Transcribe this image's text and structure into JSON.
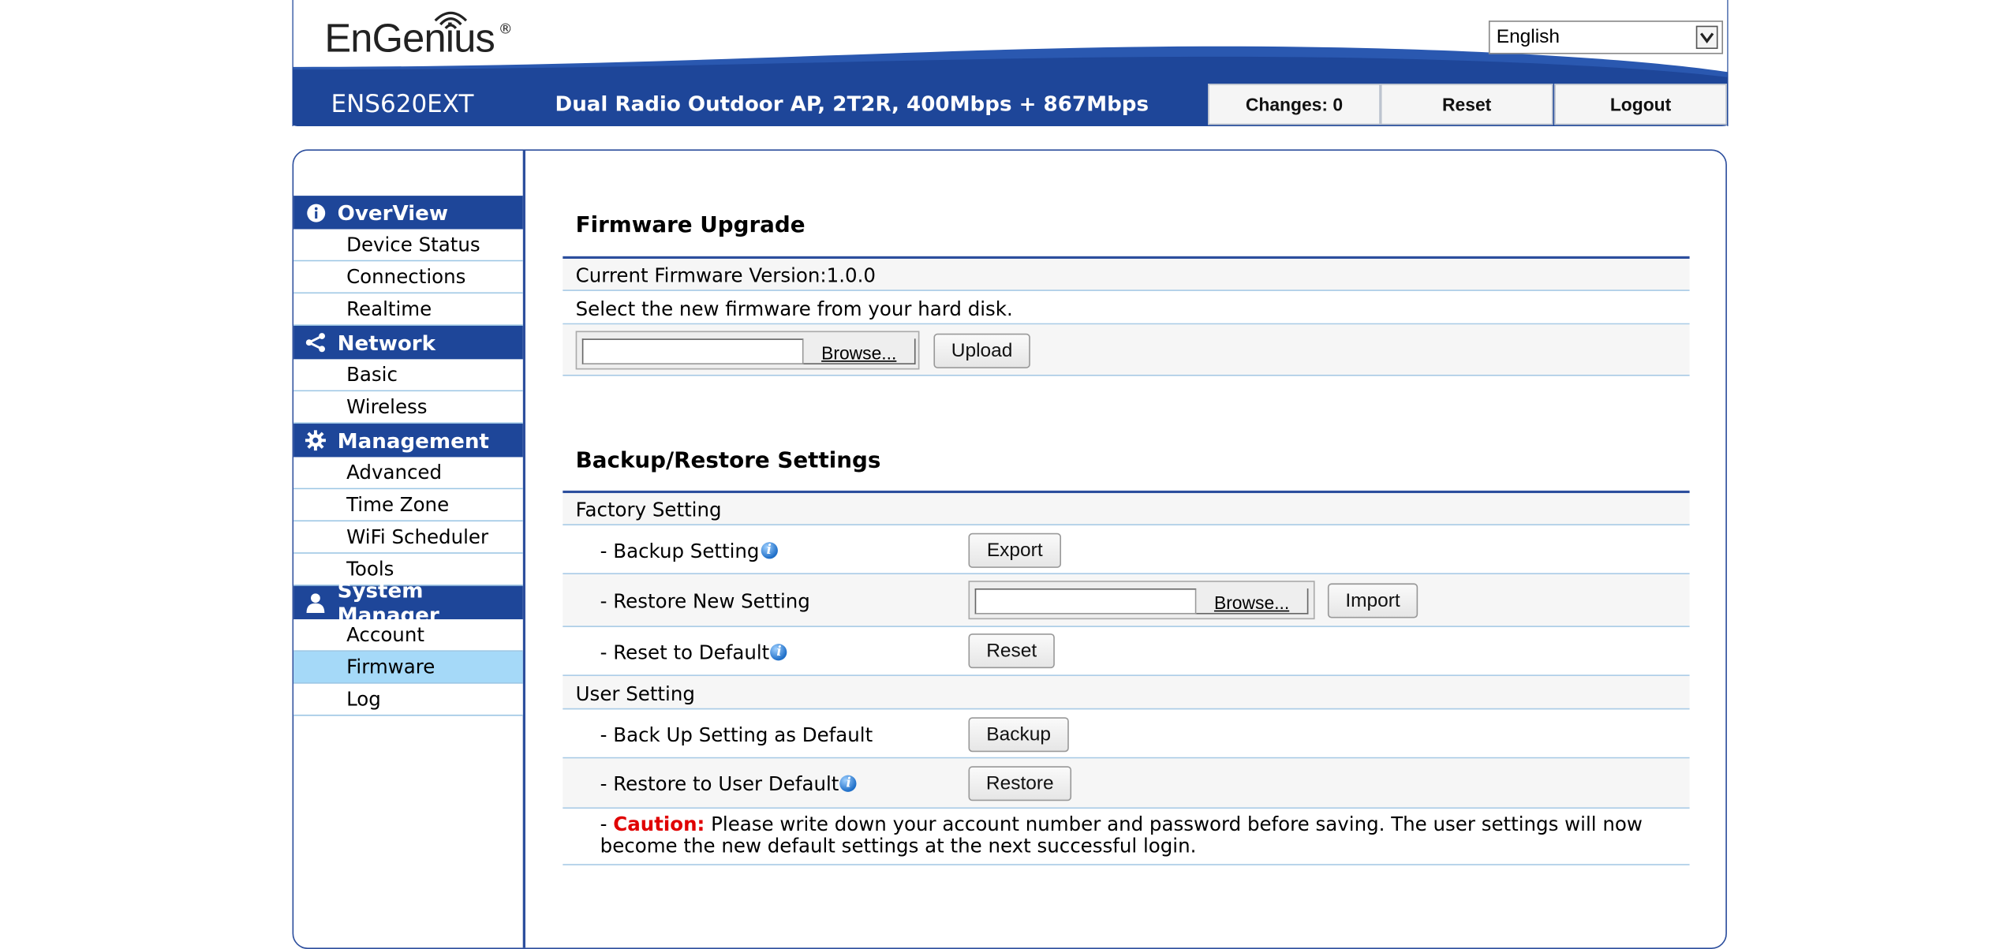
{
  "header": {
    "logo_text": "EnGenius",
    "language": "English",
    "model": "ENS620EXT",
    "description": "Dual Radio Outdoor AP, 2T2R, 400Mbps + 867Mbps",
    "changes_label": "Changes: 0",
    "reset_label": "Reset",
    "logout_label": "Logout"
  },
  "sidebar": {
    "sections": [
      {
        "title": "OverView",
        "icon": "info-icon",
        "items": [
          "Device Status",
          "Connections",
          "Realtime"
        ]
      },
      {
        "title": "Network",
        "icon": "share-icon",
        "items": [
          "Basic",
          "Wireless"
        ]
      },
      {
        "title": "Management",
        "icon": "gear-icon",
        "items": [
          "Advanced",
          "Time Zone",
          "WiFi Scheduler",
          "Tools"
        ]
      },
      {
        "title": "System Manager",
        "icon": "user-icon",
        "items": [
          "Account",
          "Firmware",
          "Log"
        ]
      }
    ],
    "active_item": "Firmware"
  },
  "firmware": {
    "title": "Firmware Upgrade",
    "current_version": "Current Firmware Version:1.0.0",
    "select_text": "Select the new firmware from your hard disk.",
    "browse_label": "Browse...",
    "upload_label": "Upload"
  },
  "backup": {
    "title": "Backup/Restore Settings",
    "factory_setting": "Factory Setting",
    "backup_setting": "- Backup Setting",
    "export_label": "Export",
    "restore_new_setting": "- Restore New Setting",
    "browse_label": "Browse...",
    "import_label": "Import",
    "reset_default": "- Reset to Default",
    "reset_label": "Reset",
    "user_setting": "User Setting",
    "backup_as_default": "- Back Up Setting as Default",
    "backup_label": "Backup",
    "restore_user_default": "- Restore to User Default",
    "restore_label": "Restore",
    "caution_prefix": "- ",
    "caution_label": "Caution:",
    "caution_text": " Please write down your account number and password before saving. The user settings will now become the new default settings at the next successful login."
  },
  "colors": {
    "brand_blue": "#1e4699",
    "active_item_bg": "#a5d9f8",
    "caution_red": "#e00000"
  }
}
